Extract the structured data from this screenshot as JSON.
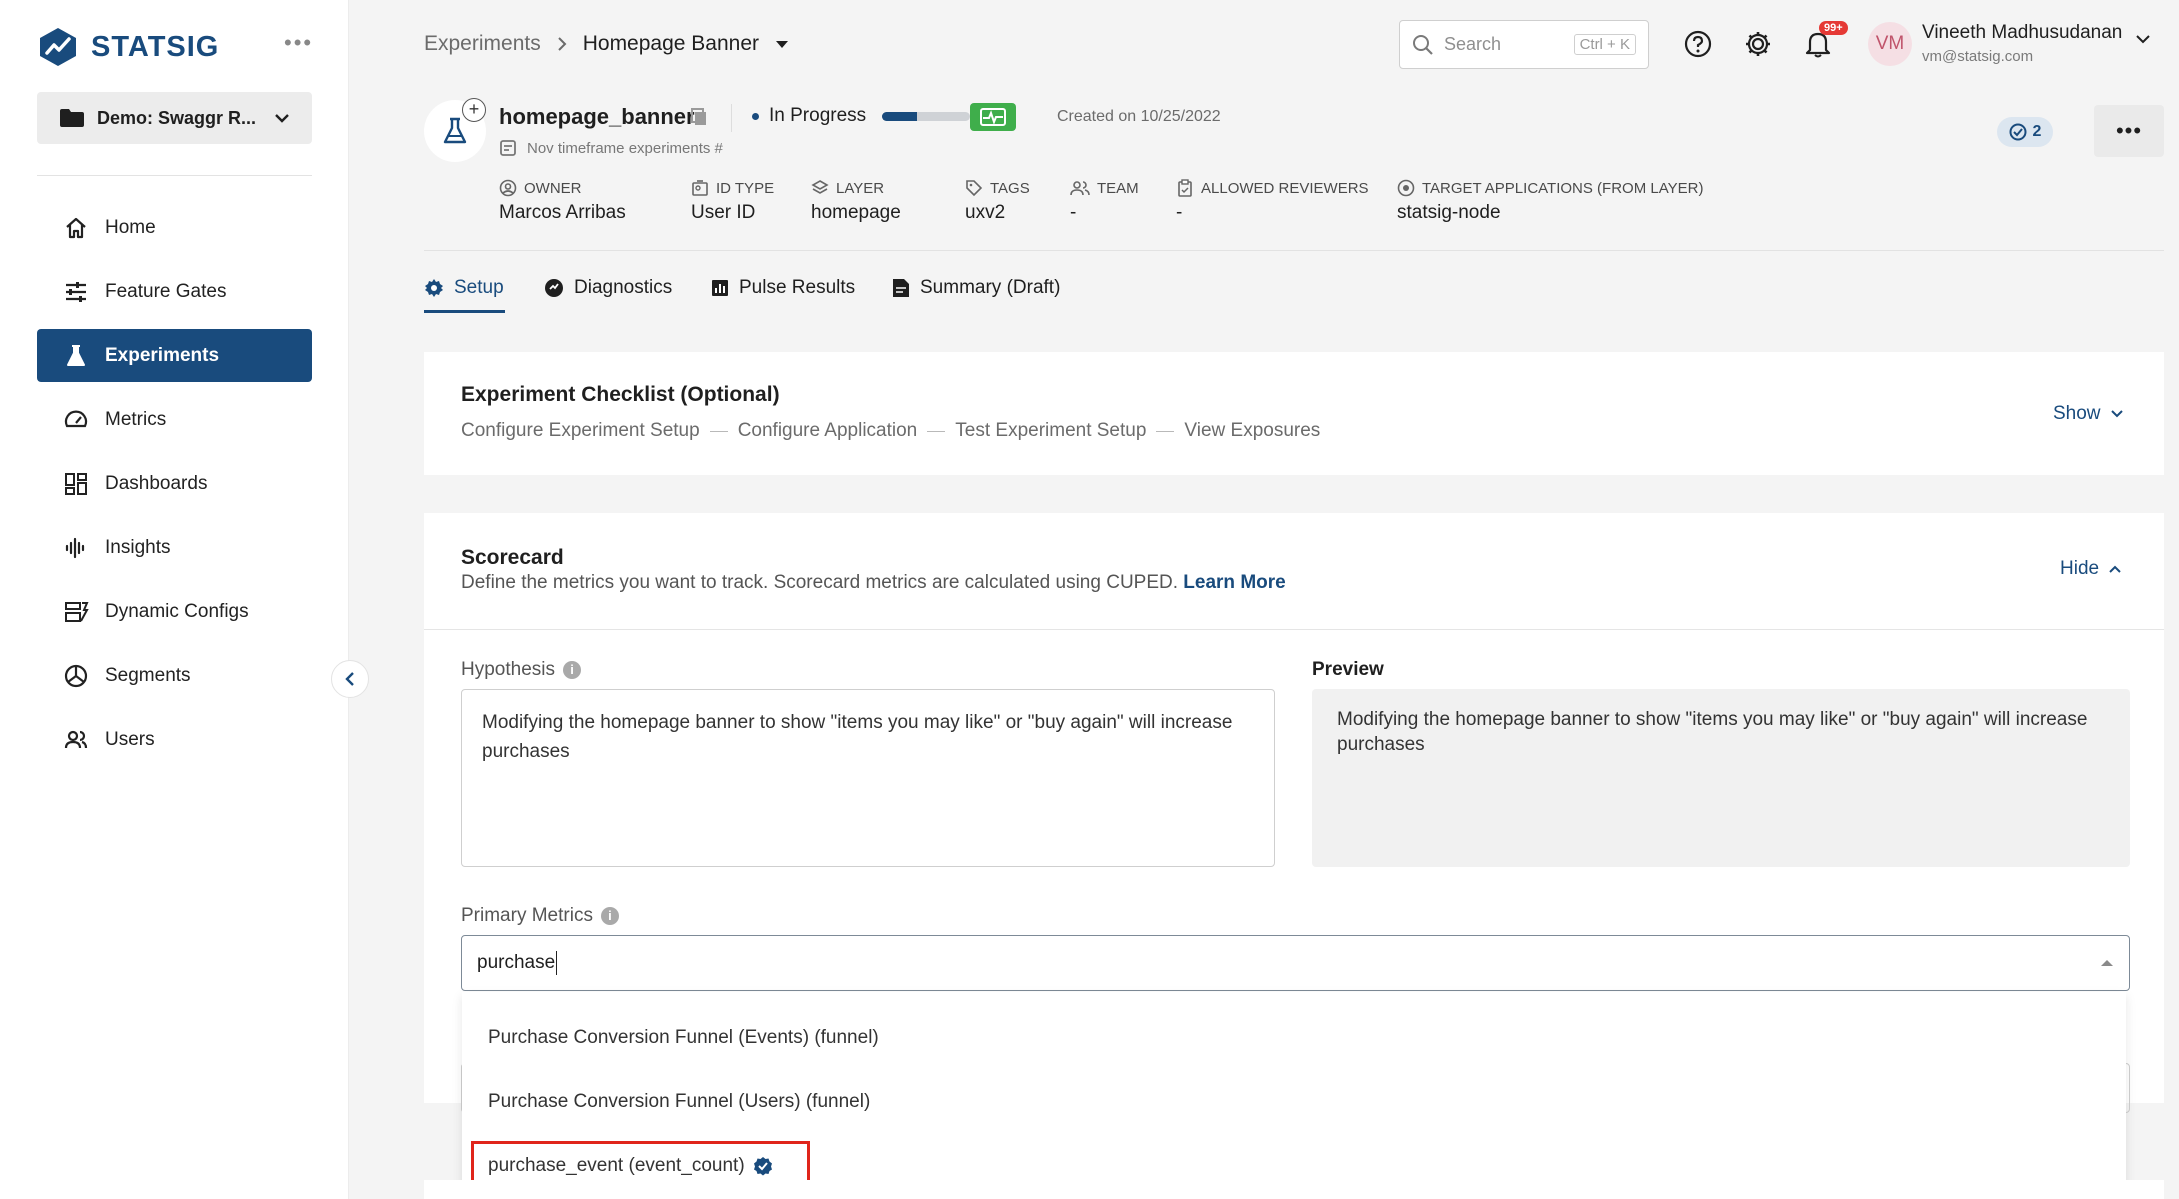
{
  "brand": {
    "name": "STATSIG",
    "accent": "#194b7d"
  },
  "sidebar": {
    "project": "Demo: Swaggr R...",
    "items": [
      {
        "label": "Home",
        "icon": "home-icon"
      },
      {
        "label": "Feature Gates",
        "icon": "sliders-icon"
      },
      {
        "label": "Experiments",
        "icon": "flask-icon",
        "active": true
      },
      {
        "label": "Metrics",
        "icon": "gauge-icon"
      },
      {
        "label": "Dashboards",
        "icon": "dashboard-icon"
      },
      {
        "label": "Insights",
        "icon": "waveform-icon"
      },
      {
        "label": "Dynamic Configs",
        "icon": "config-icon"
      },
      {
        "label": "Segments",
        "icon": "segments-icon"
      },
      {
        "label": "Users",
        "icon": "users-icon"
      }
    ]
  },
  "header": {
    "breadcrumb_parent": "Experiments",
    "breadcrumb_current": "Homepage Banner",
    "search_placeholder": "Search",
    "search_shortcut": "Ctrl + K",
    "notifications_badge": "99+",
    "user": {
      "initials": "VM",
      "name": "Vineeth Madhusudanan",
      "email": "vm@statsig.com"
    }
  },
  "experiment": {
    "name": "homepage_banner",
    "status": "In Progress",
    "progress_fraction": 0.4,
    "created": "Created on 10/25/2022",
    "description": "Nov timeframe experiments #",
    "reviewers_count": "2",
    "meta": [
      {
        "label": "OWNER",
        "value": "Marcos Arribas",
        "icon": "user-circle-icon"
      },
      {
        "label": "ID TYPE",
        "value": "User ID",
        "icon": "id-card-icon"
      },
      {
        "label": "LAYER",
        "value": "homepage",
        "icon": "layers-icon"
      },
      {
        "label": "TAGS",
        "value": "uxv2",
        "icon": "tag-icon"
      },
      {
        "label": "TEAM",
        "value": "-",
        "icon": "team-icon"
      },
      {
        "label": "ALLOWED REVIEWERS",
        "value": "-",
        "icon": "clipboard-icon"
      },
      {
        "label": "TARGET APPLICATIONS (FROM LAYER)",
        "value": "statsig-node",
        "icon": "target-icon"
      }
    ]
  },
  "tabs": [
    {
      "label": "Setup",
      "icon": "gear-icon",
      "active": true
    },
    {
      "label": "Diagnostics",
      "icon": "diagnostics-icon"
    },
    {
      "label": "Pulse Results",
      "icon": "bar-chart-icon"
    },
    {
      "label": "Summary (Draft)",
      "icon": "document-icon"
    }
  ],
  "checklist": {
    "title": "Experiment Checklist (Optional)",
    "steps": [
      "Configure Experiment Setup",
      "Configure Application",
      "Test Experiment Setup",
      "View Exposures"
    ],
    "toggle": "Show"
  },
  "scorecard": {
    "title": "Scorecard",
    "description": "Define the metrics you want to track. Scorecard metrics are calculated using CUPED.",
    "learn_more": "Learn More",
    "toggle": "Hide",
    "hypothesis_label": "Hypothesis",
    "hypothesis": "Modifying the homepage banner to show \"items you may like\" or \"buy again\" will increase purchases",
    "preview_label": "Preview",
    "preview": "Modifying the homepage banner to show \"items you may like\" or \"buy again\" will increase purchases",
    "primary_metrics_label": "Primary Metrics",
    "primary_metrics_value": "purchase",
    "options": [
      "Purchase Conversion Funnel (Events) (funnel)",
      "Purchase Conversion Funnel (Users) (funnel)",
      "purchase_event (event_count)"
    ]
  }
}
